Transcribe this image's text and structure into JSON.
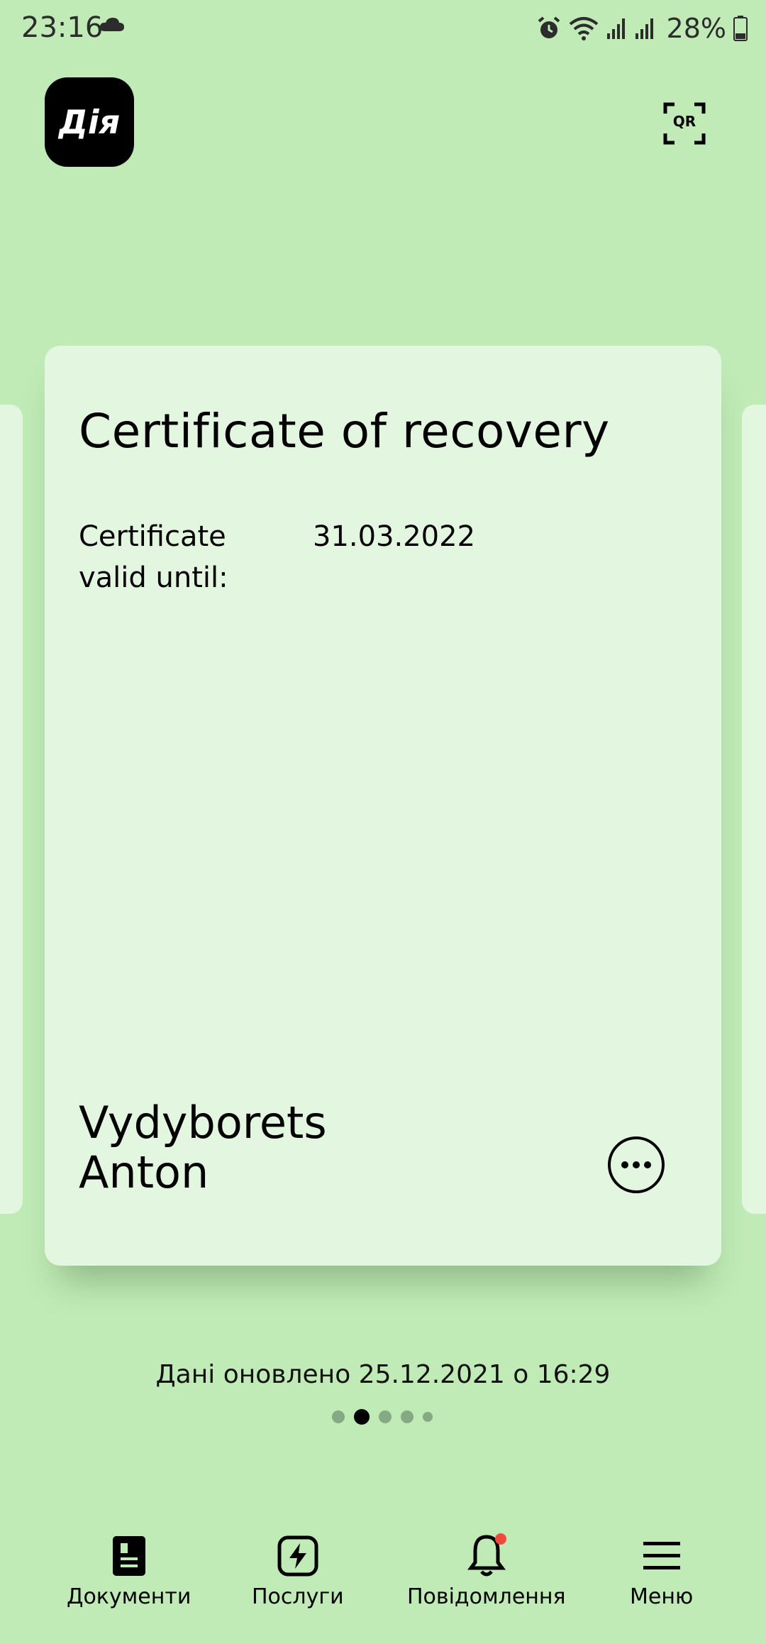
{
  "status_bar": {
    "time": "23:16",
    "battery": "28%",
    "icons": [
      "cloud-icon",
      "alarm-icon",
      "wifi-icon",
      "signal-icon",
      "signal-icon",
      "battery-icon"
    ]
  },
  "header": {
    "logo_text": "Дія",
    "qr_label": "QR"
  },
  "card": {
    "title": "Certificate of recovery",
    "valid_label": "Certificate valid until:",
    "valid_value": "31.03.2022",
    "holder_surname": "Vydyborets",
    "holder_name": "Anton"
  },
  "updated_text": "Дані оновлено 25.12.2021 о 16:29",
  "pager": {
    "total": 5,
    "active_index": 1
  },
  "bottom_nav": {
    "documents": "Документи",
    "services": "Послуги",
    "notifications": "Повідомлення",
    "menu": "Меню"
  },
  "colors": {
    "background": "#c0ebb7",
    "card": "#e3f6df",
    "notification_badge": "#f04a3e"
  }
}
